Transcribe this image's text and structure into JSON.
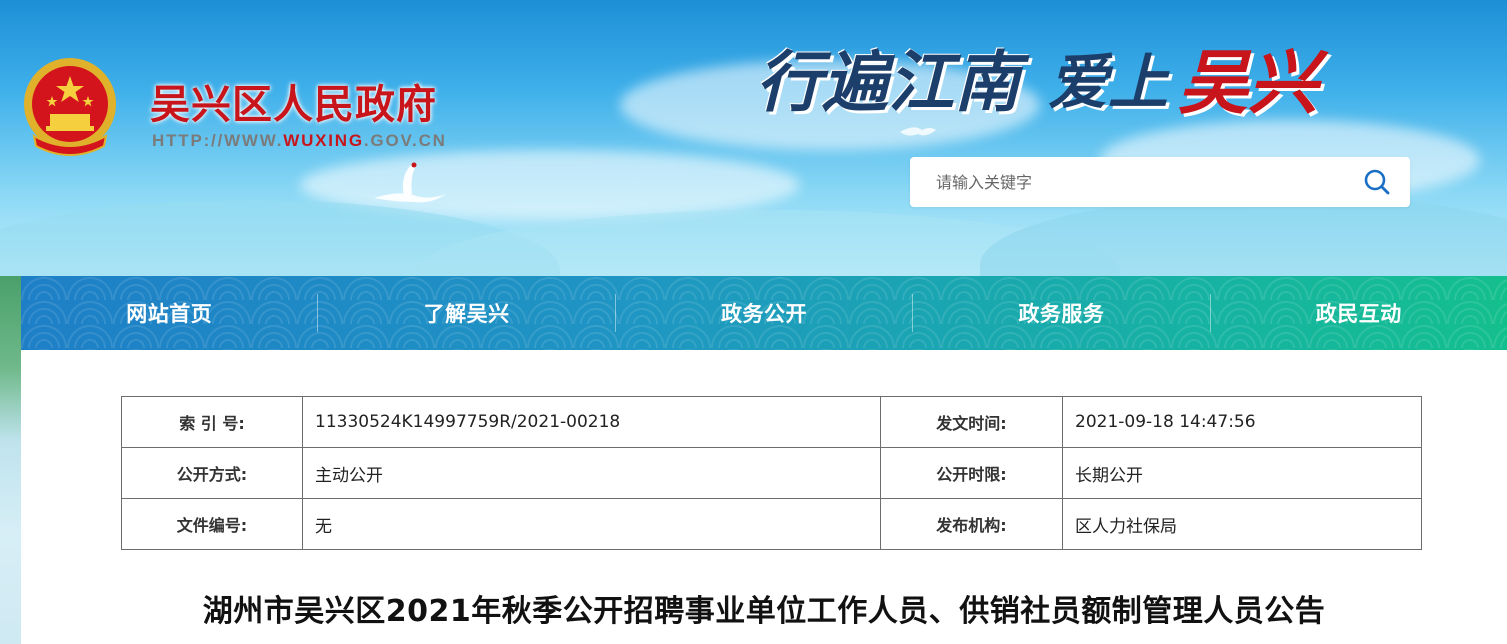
{
  "header": {
    "site_title": "吴兴区人民政府",
    "site_url_prefix": "HTTP://WWW.",
    "site_url_highlight": "WUXING",
    "site_url_suffix": ".GOV.CN",
    "slogan_part1": "行遍江南",
    "slogan_part2": "爱上",
    "slogan_part3": "吴兴",
    "search_placeholder": "请输入关键字",
    "emblem_icon": "national-emblem-icon",
    "search_icon": "search-icon"
  },
  "nav": {
    "items": [
      {
        "label": "网站首页"
      },
      {
        "label": "了解吴兴"
      },
      {
        "label": "政务公开"
      },
      {
        "label": "政务服务"
      },
      {
        "label": "政民互动"
      }
    ]
  },
  "meta": {
    "rows": [
      {
        "label1": "索 引 号:",
        "value1": "11330524K14997759R/2021-00218",
        "label2": "发文时间:",
        "value2": "2021-09-18 14:47:56"
      },
      {
        "label1": "公开方式:",
        "value1": "主动公开",
        "label2": "公开时限:",
        "value2": "长期公开"
      },
      {
        "label1": "文件编号:",
        "value1": "无",
        "label2": "发布机构:",
        "value2": "区人力社保局"
      }
    ]
  },
  "article": {
    "title": "湖州市吴兴区2021年秋季公开招聘事业单位工作人员、供销社员额制管理人员公告"
  },
  "colors": {
    "brand_red": "#c8141b",
    "slogan_blue": "#1c3e6b",
    "nav_start": "#1e7fc6",
    "nav_end": "#14bf8e"
  }
}
